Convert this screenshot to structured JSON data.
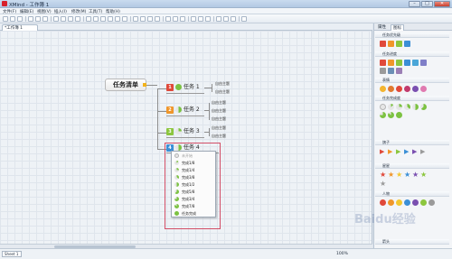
{
  "window": {
    "title": "XMind - 工作簿 1"
  },
  "menu": [
    "文件(F)",
    "编辑(E)",
    "视图(V)",
    "插入(I)",
    "修改(M)",
    "工具(T)",
    "帮助(H)"
  ],
  "editor": {
    "tab_label": "*工作簿 1"
  },
  "mindmap": {
    "central": "任务清单",
    "topics": [
      {
        "num": "1",
        "label": "任务 1",
        "num_color": "#e0493a",
        "subtopics": [
          "自由主题",
          "自由主题"
        ]
      },
      {
        "num": "2",
        "label": "任务 2",
        "num_color": "#f0962a",
        "subtopics": [
          "自由主题",
          "自由主题",
          "自由主题"
        ]
      },
      {
        "num": "3",
        "label": "任务 3",
        "num_color": "#8cc63e",
        "subtopics": [
          "自由主题",
          "自由主题"
        ]
      },
      {
        "num": "4",
        "label": "任务 4",
        "num_color": "#3b8fd6",
        "subtopics": []
      }
    ]
  },
  "progress_menu": {
    "items": [
      "未开始",
      "完成1/8",
      "完成1/4",
      "完成3/8",
      "完成1/2",
      "完成5/8",
      "完成3/4",
      "完成7/8",
      "任务完成"
    ]
  },
  "panel": {
    "tabs": [
      "属性",
      "图标"
    ],
    "sections": [
      "任务优先级",
      "任务进度",
      "表情",
      "任务完成度",
      "旗子",
      "星星",
      "人物",
      "箭头"
    ]
  },
  "status": {
    "sheet": "Sheet 1",
    "zoom": "100%"
  },
  "watermark": "Baidu经验",
  "colors": {
    "priority_red": "#e0493a",
    "priority_orange": "#f0962a",
    "priority_green": "#8cc63e",
    "priority_blue": "#3b8fd6",
    "progress_green": "#7cc242"
  }
}
